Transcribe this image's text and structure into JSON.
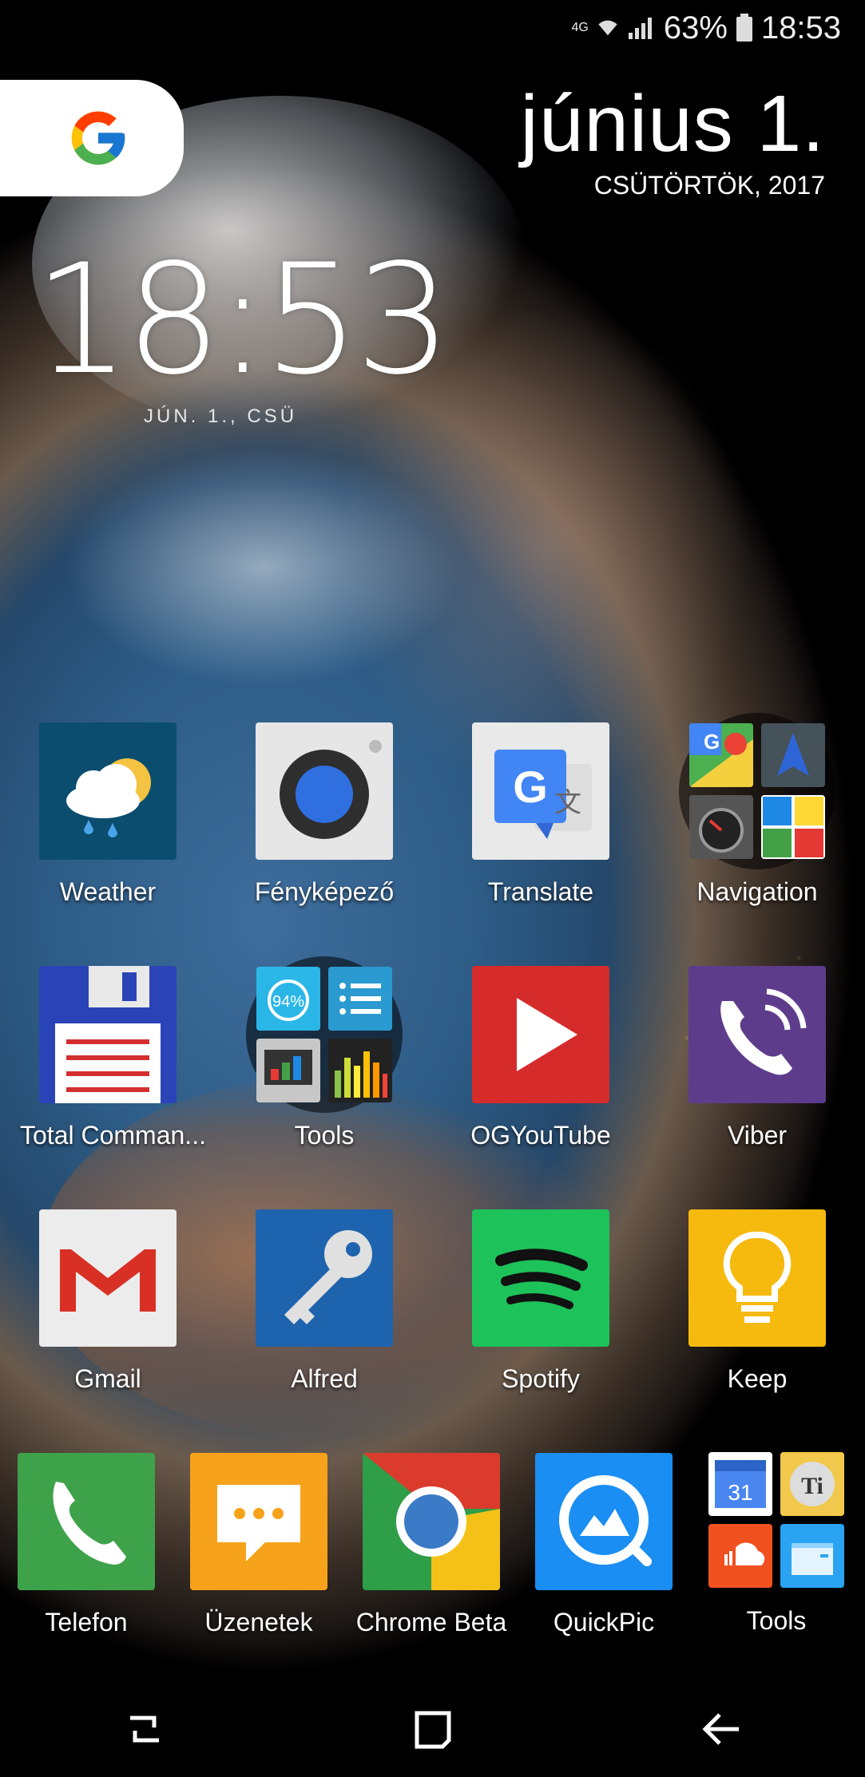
{
  "status_bar": {
    "network": "4G",
    "battery": "63%",
    "time": "18:53"
  },
  "date_widget": {
    "date": "június 1.",
    "weekday_year": "CSÜTÖRTÖK, 2017"
  },
  "clock_widget": {
    "time": "18:53",
    "date": "JÚN. 1., CSÜ"
  },
  "google_widget": {
    "logo": "G"
  },
  "apps": [
    {
      "label": "Weather",
      "icon": "weather-icon",
      "color": "#0b4d6f"
    },
    {
      "label": "Fényképező",
      "icon": "camera-icon",
      "color": "#e6e6e6"
    },
    {
      "label": "Translate",
      "icon": "translate-icon",
      "color": "#e9e9e9"
    },
    {
      "label": "Navigation",
      "icon": "folder-icon"
    },
    {
      "label": "Total Comman...",
      "icon": "floppy-disk-icon",
      "color": "#2a44b8"
    },
    {
      "label": "Tools",
      "icon": "folder-icon"
    },
    {
      "label": "OGYouTube",
      "icon": "play-icon",
      "color": "#d62b2b"
    },
    {
      "label": "Viber",
      "icon": "phone-waves-icon",
      "color": "#5e3c8c"
    },
    {
      "label": "Gmail",
      "icon": "gmail-icon",
      "color": "#ececec"
    },
    {
      "label": "Alfred",
      "icon": "key-icon",
      "color": "#1e63ad"
    },
    {
      "label": "Spotify",
      "icon": "spotify-icon",
      "color": "#1ec25a"
    },
    {
      "label": "Keep",
      "icon": "lightbulb-icon",
      "color": "#f6b90d"
    }
  ],
  "dock": [
    {
      "label": "Telefon",
      "icon": "phone-icon",
      "color": "#3ea24a"
    },
    {
      "label": "Üzenetek",
      "icon": "message-icon",
      "color": "#f7a21b"
    },
    {
      "label": "Chrome Beta",
      "icon": "chrome-icon"
    },
    {
      "label": "QuickPic",
      "icon": "quickpic-icon",
      "color": "#1a8ef2"
    },
    {
      "label": "Tools",
      "icon": "folder-icon"
    }
  ],
  "folder_minis": {
    "calendar_day": "31"
  },
  "tool_badges": {
    "battery_percent": "94%"
  }
}
